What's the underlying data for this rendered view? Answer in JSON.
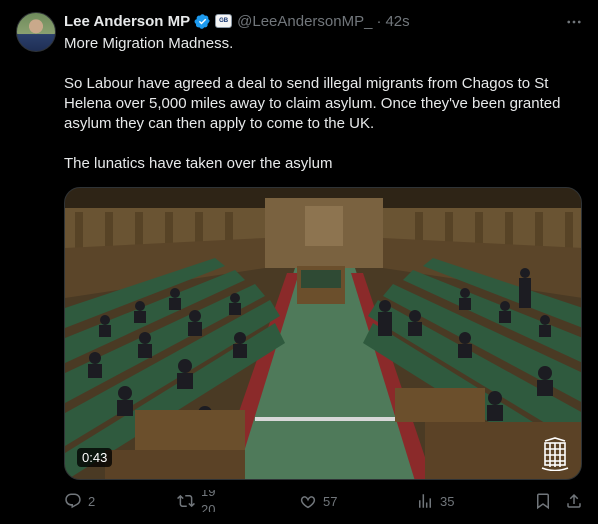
{
  "author": {
    "display_name": "Lee Anderson MP",
    "affiliation_badge": "GB",
    "handle": "@LeeAndersonMP_",
    "separator": "·",
    "time": "42s"
  },
  "tweet": {
    "paragraphs": [
      "More Migration Madness.",
      "So Labour have agreed a deal to send illegal migrants from Chagos to St Helena over 5,000 miles away to claim asylum. Once they've been granted asylum they can then apply to come to the UK.",
      "The lunatics have taken over the asylum"
    ]
  },
  "media": {
    "duration": "0:43"
  },
  "actions": {
    "replies": "2",
    "reposts_old": "19",
    "reposts_new": "20",
    "likes": "57",
    "views": "35"
  },
  "icons": {
    "verified": "verified-badge-icon",
    "more": "more-dots-icon",
    "reply": "reply-bubble-icon",
    "repost": "repost-arrows-icon",
    "like": "heart-icon",
    "views": "bar-chart-icon",
    "bookmark": "bookmark-icon",
    "share": "share-upload-icon"
  },
  "colors": {
    "background": "#000000",
    "text": "#e7e9ea",
    "muted": "#71767b",
    "verified_blue": "#1d9bf0",
    "bench_green": "#2f5a3e"
  }
}
